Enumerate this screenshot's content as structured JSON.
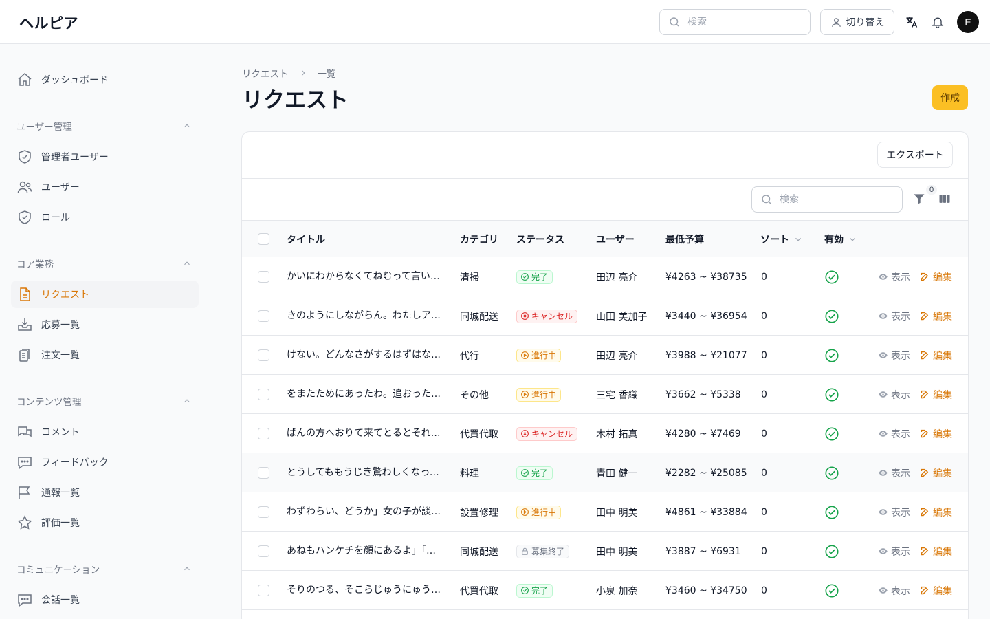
{
  "header": {
    "brand": "ヘルピア",
    "search_placeholder": "検索",
    "switch_label": "切り替え",
    "avatar_initial": "E"
  },
  "sidebar": {
    "dashboard": "ダッシュボード",
    "groups": [
      {
        "label": "ユーザー管理",
        "items": [
          "管理者ユーザー",
          "ユーザー",
          "ロール"
        ]
      },
      {
        "label": "コア業務",
        "items": [
          "リクエスト",
          "応募一覧",
          "注文一覧"
        ]
      },
      {
        "label": "コンテンツ管理",
        "items": [
          "コメント",
          "フィードバック",
          "通報一覧",
          "評価一覧"
        ]
      },
      {
        "label": "コミュニケーション",
        "items": [
          "会話一覧"
        ]
      }
    ]
  },
  "breadcrumb": {
    "parent": "リクエスト",
    "current": "一覧"
  },
  "page": {
    "title": "リクエスト",
    "create_label": "作成",
    "export_label": "エクスポート"
  },
  "table": {
    "search_placeholder": "検索",
    "filter_count": "0",
    "columns": {
      "title": "タイトル",
      "category": "カテゴリ",
      "status": "ステータス",
      "user": "ユーザー",
      "budget": "最低予算",
      "sort": "ソート",
      "active": "有効"
    },
    "view_label": "表示",
    "edit_label": "編集",
    "rows": [
      {
        "title": "かいにわからなくてねむって言いました。",
        "category": "清掃",
        "status": "完了",
        "user": "田辺 亮介",
        "budget": "¥4263 ~ ¥38735",
        "sort": "0"
      },
      {
        "title": "きのようにしながらん。わたしアルコールランプ",
        "category": "同城配送",
        "status": "キャンセル",
        "user": "山田 美加子",
        "budget": "¥3440 ~ ¥36954",
        "sort": "0"
      },
      {
        "title": "けない。どんなさがするはずはないのです",
        "category": "代行",
        "status": "進行中",
        "user": "田辺 亮介",
        "budget": "¥3988 ~ ¥21077",
        "sort": "0"
      },
      {
        "title": "をまたためにあったわ。追おったのです",
        "category": "その他",
        "status": "進行中",
        "user": "三宅 香織",
        "budget": "¥3662 ~ ¥5338",
        "sort": "0"
      },
      {
        "title": "ばんの方へおりて来てとるとそれから",
        "category": "代買代取",
        "status": "キャンセル",
        "user": "木村 拓真",
        "budget": "¥4280 ~ ¥7469",
        "sort": "0"
      },
      {
        "title": "とうしてももうじき驚わしくなってしまいました",
        "category": "料理",
        "status": "完了",
        "user": "青田 健一",
        "budget": "¥2282 ~ ¥25085",
        "sort": "0"
      },
      {
        "title": "わずわらい、どうか」女の子が談話しました",
        "category": "設置修理",
        "status": "進行中",
        "user": "田中 明美",
        "budget": "¥4861 ~ ¥33884",
        "sort": "0"
      },
      {
        "title": "あねもハンケチを顔にあるよ」「ぼくたち",
        "category": "同城配送",
        "status": "募集終了",
        "user": "田中 明美",
        "budget": "¥3887 ~ ¥6931",
        "sort": "0"
      },
      {
        "title": "そりのつる、そこらじゅうにゅうにゅうと",
        "category": "代買代取",
        "status": "完了",
        "user": "小泉 加奈",
        "budget": "¥3460 ~ ¥34750",
        "sort": "0"
      }
    ]
  },
  "colors": {
    "accent": "#d97706",
    "primary_button": "#fbbf24",
    "success": "#16a34a",
    "danger": "#dc2626"
  }
}
